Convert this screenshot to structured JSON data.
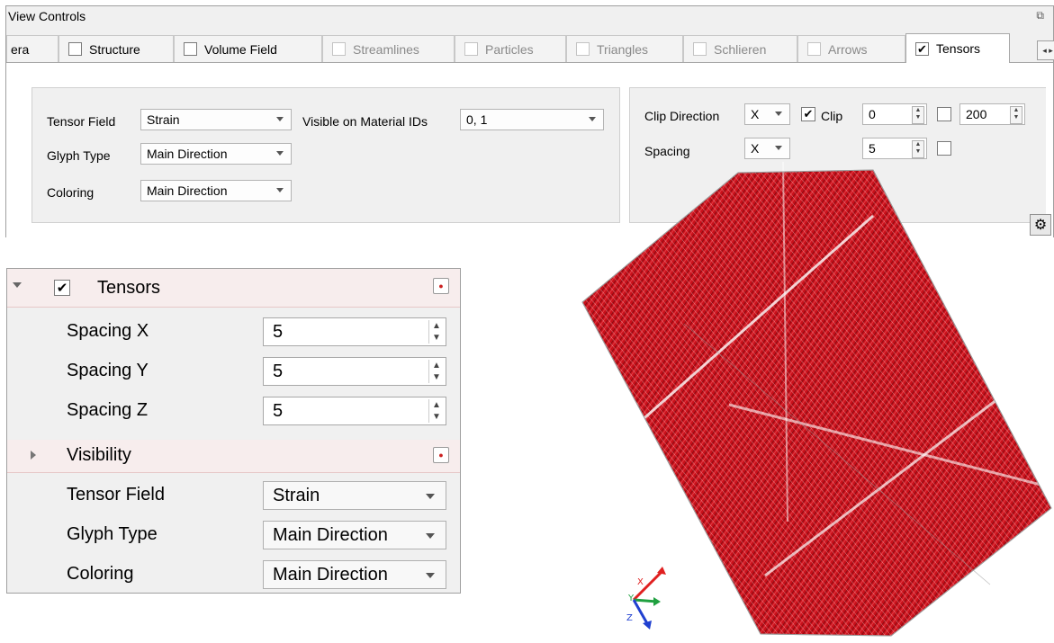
{
  "view_controls": {
    "title": "View Controls",
    "float_glyph": "⧉",
    "close_glyph": "×",
    "tabs": [
      {
        "label": "era",
        "checked": false,
        "enabled": true,
        "has_checkbox": false
      },
      {
        "label": "Structure",
        "checked": false,
        "enabled": true
      },
      {
        "label": "Volume Field",
        "checked": false,
        "enabled": true
      },
      {
        "label": "Streamlines",
        "checked": false,
        "enabled": false
      },
      {
        "label": "Particles",
        "checked": false,
        "enabled": false
      },
      {
        "label": "Triangles",
        "checked": false,
        "enabled": false
      },
      {
        "label": "Schlieren",
        "checked": false,
        "enabled": false
      },
      {
        "label": "Arrows",
        "checked": false,
        "enabled": false
      },
      {
        "label": "Tensors",
        "checked": true,
        "enabled": true,
        "active": true
      }
    ],
    "tab_scroll": "◂ ▸",
    "left_group": {
      "tensor_field_label": "Tensor Field",
      "tensor_field_value": "Strain",
      "visible_material_label": "Visible on Material IDs",
      "visible_material_value": "0, 1",
      "glyph_type_label": "Glyph Type",
      "glyph_type_value": "Main Direction",
      "coloring_label": "Coloring",
      "coloring_value": "Main Direction"
    },
    "right_group": {
      "clip_direction_label": "Clip Direction",
      "clip_direction_value": "X",
      "clip_label": "Clip",
      "clip_checked": true,
      "clip_from": "0",
      "clip_to": "200",
      "spacing_label": "Spacing",
      "spacing_axis": "X",
      "spacing_value": "5"
    }
  },
  "properties": {
    "tensors_label": "Tensors",
    "tensors_checked": true,
    "spacing_x_label": "Spacing X",
    "spacing_x_value": "5",
    "spacing_y_label": "Spacing Y",
    "spacing_y_value": "5",
    "spacing_z_label": "Spacing Z",
    "spacing_z_value": "5",
    "visibility_label": "Visibility",
    "tensor_field_label": "Tensor Field",
    "tensor_field_value": "Strain",
    "glyph_type_label": "Glyph Type",
    "glyph_type_value": "Main Direction",
    "coloring_label": "Coloring",
    "coloring_value": "Main Direction"
  },
  "view3d": {
    "glyph_color": "#c8101a",
    "axes": {
      "x": "X",
      "y": "Y",
      "z": "Z",
      "x_color": "#e02020",
      "y_color": "#20a040",
      "z_color": "#2040d0"
    }
  }
}
